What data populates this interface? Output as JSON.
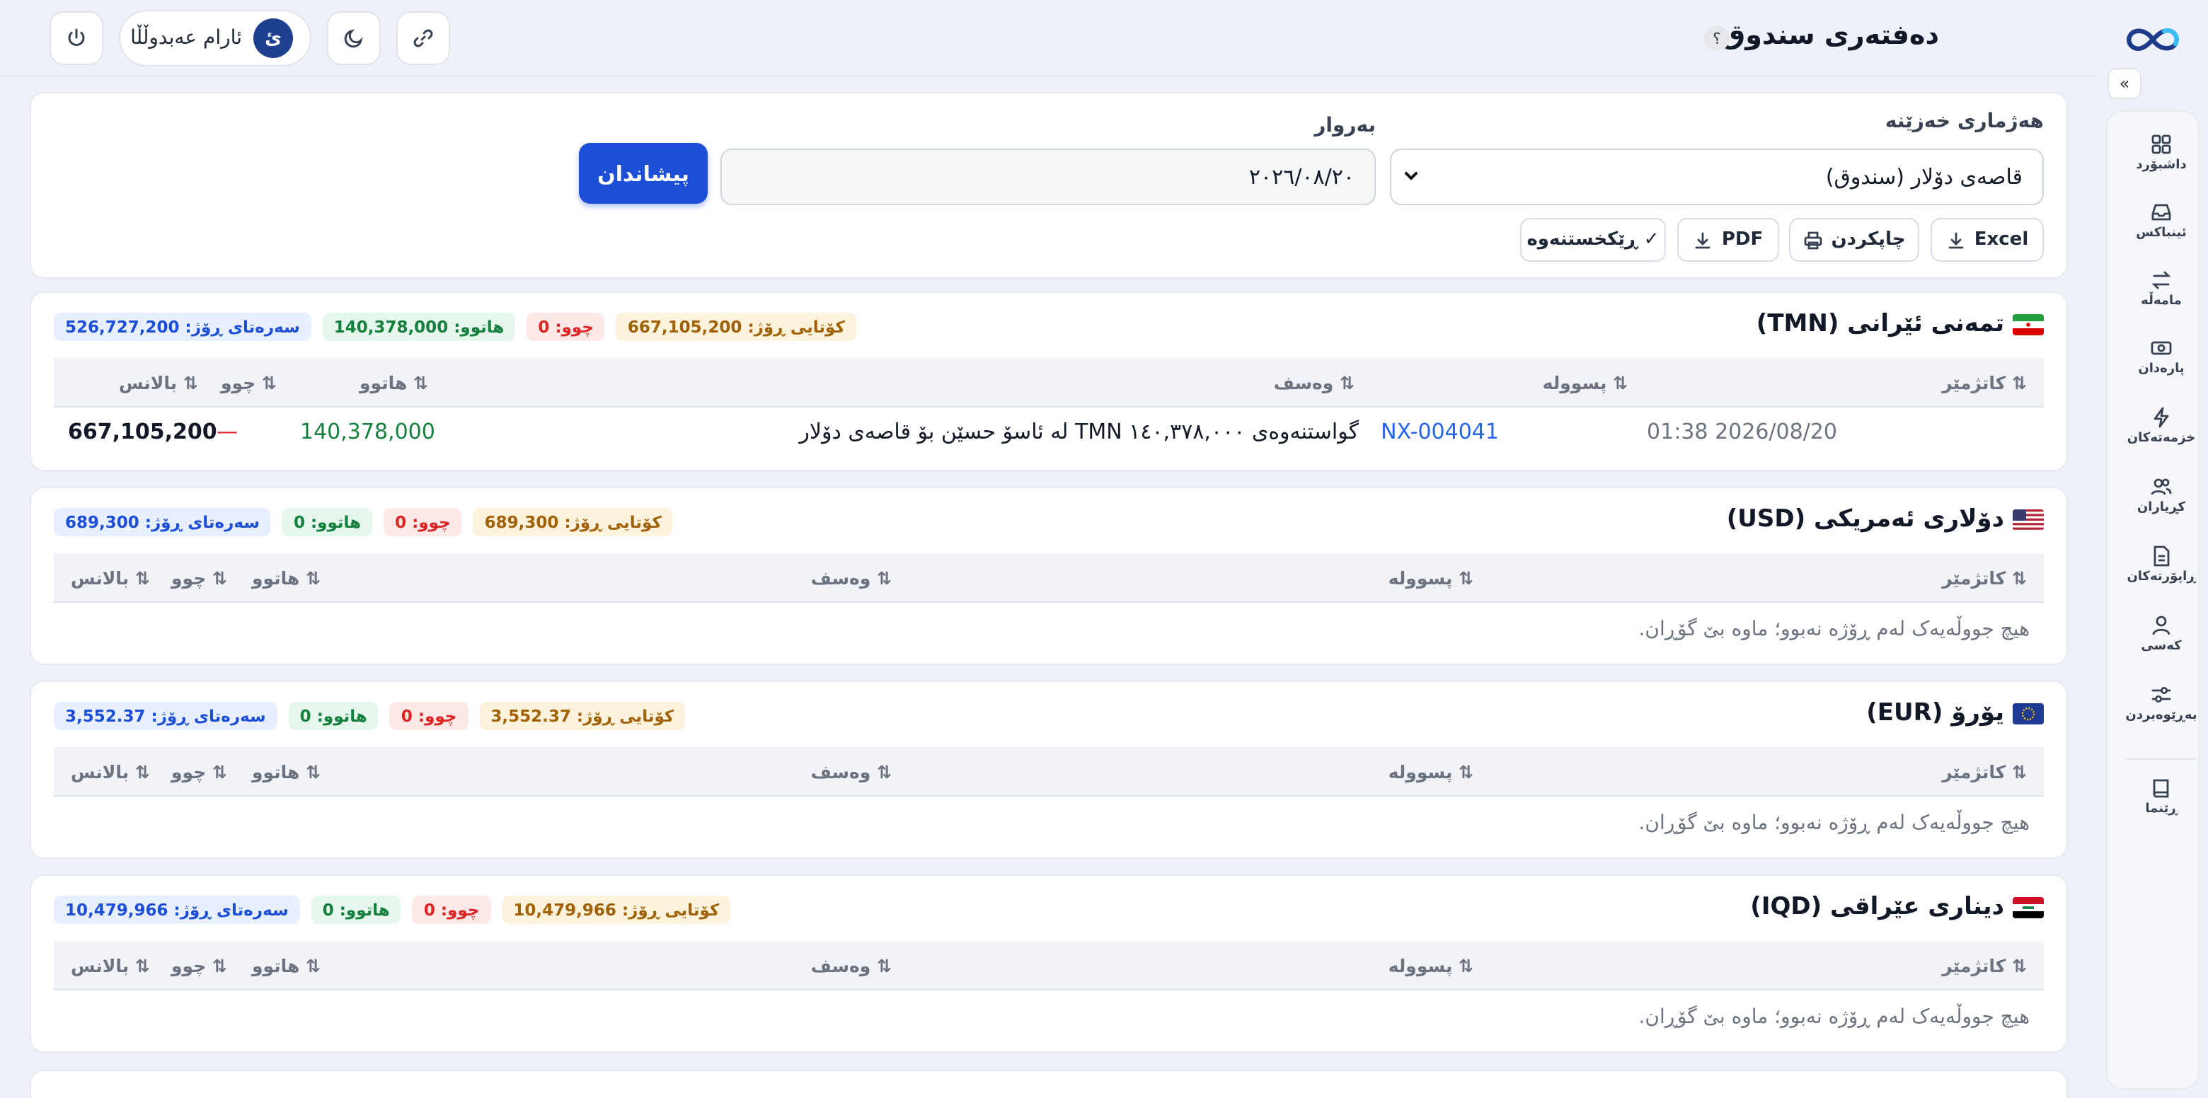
{
  "header": {
    "title": "دەفتەری سندوق",
    "help": "؟",
    "user": {
      "initial": "ئ",
      "name": "ئارام عەبدوڵڵا"
    }
  },
  "nav": [
    {
      "label": "داشبۆرد",
      "icon": "dashboard-icon"
    },
    {
      "label": "ئینباکس",
      "icon": "inbox-icon"
    },
    {
      "label": "مامەڵە",
      "icon": "transfer-icon"
    },
    {
      "label": "پارەدان",
      "icon": "cash-icon"
    },
    {
      "label": "خزمەتەکان",
      "icon": "bolt-icon"
    },
    {
      "label": "کڕیاران",
      "icon": "users-icon"
    },
    {
      "label": "ڕاپۆرتەکان",
      "icon": "report-icon"
    },
    {
      "label": "کەسی",
      "icon": "user-icon"
    },
    {
      "label": "بەڕێوەبردن",
      "icon": "sliders-icon"
    },
    {
      "label": "ڕێنما",
      "icon": "book-icon"
    }
  ],
  "filters": {
    "account_label": "هەژماری خەزێنە",
    "account_value": "قاصەی دۆلار (سندوق)",
    "date_label": "بەروار",
    "date_value": "٢٠٢٦/٠٨/٢٠",
    "show_label": "پیشاندان",
    "actions": {
      "excel": "Excel",
      "print": "چاپکردن",
      "pdf": "PDF",
      "reconcile": "✓ ڕێکخستنەوە"
    }
  },
  "columns": {
    "date": "⇅ کاتژمێر",
    "receipt": "⇅ پسوولە",
    "desc": "⇅ وەسف",
    "in": "⇅ هاتوو",
    "out": "⇅ چوو",
    "balance": "⇅ بالانس"
  },
  "empty_text": "هیچ جووڵەیەک لەم ڕۆژە نەبوو؛ ماوە بێ گۆڕان.",
  "currencies": [
    {
      "title": "تمەنی ئێرانی (TMN)",
      "flag": "iran-flag",
      "stats": {
        "opening": "سەرەتای ڕۆژ: 526,727,200",
        "in": "هاتوو: 140,378,000",
        "out": "چوو: 0",
        "closing": "کۆتایی ڕۆژ: 667,105,200"
      },
      "rows": [
        {
          "date": "2026/08/20 01:38",
          "receipt": "NX-004041",
          "desc": "گواستنەوەی ١٤٠,٣٧٨,٠٠٠ TMN لە ئاسۆ حسێن بۆ قاصەی دۆلار",
          "in": "140,378,000",
          "out": "—",
          "balance": "667,105,200"
        }
      ]
    },
    {
      "title": "دۆلاری ئەمریکی (USD)",
      "flag": "us-flag",
      "stats": {
        "opening": "سەرەتای ڕۆژ: 689,300",
        "in": "هاتوو: 0",
        "out": "چوو: 0",
        "closing": "کۆتایی ڕۆژ: 689,300"
      },
      "rows": []
    },
    {
      "title": "یۆرۆ (EUR)",
      "flag": "eu-flag",
      "stats": {
        "opening": "سەرەتای ڕۆژ: 3,552.37",
        "in": "هاتوو: 0",
        "out": "چوو: 0",
        "closing": "کۆتایی ڕۆژ: 3,552.37"
      },
      "rows": []
    },
    {
      "title": "دیناری عێراقی (IQD)",
      "flag": "iraq-flag",
      "stats": {
        "opening": "سەرەتای ڕۆژ: 10,479,966",
        "in": "هاتوو: 0",
        "out": "چوو: 0",
        "closing": "کۆتایی ڕۆژ: 10,479,966"
      },
      "rows": []
    }
  ],
  "colors": {
    "accent": "#1d4ed8",
    "in": "#15803d",
    "out": "#dc2626",
    "link": "#2563eb"
  }
}
